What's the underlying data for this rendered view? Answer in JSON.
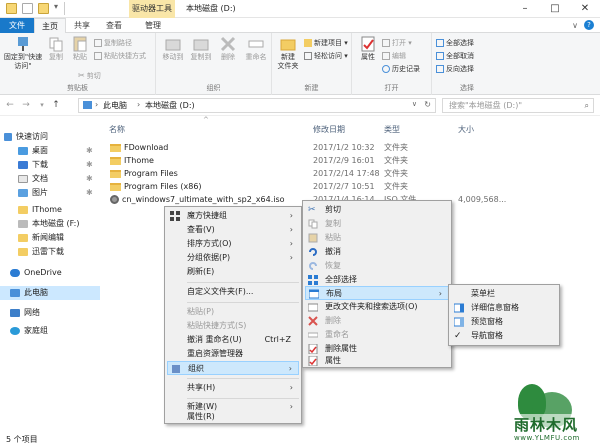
{
  "window": {
    "title": "本地磁盘 (D:)",
    "context_tab": "驱动器工具"
  },
  "ribbon_tabs": [
    {
      "label": "文件"
    },
    {
      "label": "主页"
    },
    {
      "label": "共享"
    },
    {
      "label": "查看"
    },
    {
      "label": "管理"
    }
  ],
  "ribbon": {
    "clipboard": {
      "label": "剪贴板",
      "pin": "固定到\"快速访问\"",
      "copy": "复制",
      "paste": "粘贴",
      "copy_path": "复制路径",
      "paste_shortcut": "粘贴快捷方式",
      "cut": "剪切"
    },
    "organize": {
      "label": "组织",
      "move_to": "移动到",
      "copy_to": "复制到",
      "delete": "删除",
      "rename": "重命名"
    },
    "new": {
      "label": "新建",
      "new_folder": "新建\n文件夹",
      "new_item": "新建项目",
      "easy_access": "轻松访问"
    },
    "open": {
      "label": "打开",
      "properties": "属性",
      "open": "打开",
      "edit": "编辑",
      "history": "历史记录"
    },
    "select": {
      "label": "选择",
      "select_all": "全部选择",
      "select_none": "全部取消",
      "invert": "反向选择"
    }
  },
  "address": {
    "path": [
      "此电脑",
      "本地磁盘 (D:)"
    ],
    "search_placeholder": "搜索\"本地磁盘 (D:)\""
  },
  "sidebar": {
    "items": [
      {
        "label": "快速访问"
      },
      {
        "label": "桌面"
      },
      {
        "label": "下载"
      },
      {
        "label": "文档"
      },
      {
        "label": "图片"
      },
      {
        "label": "IThome"
      },
      {
        "label": "本地磁盘 (F:)"
      },
      {
        "label": "新闻编辑"
      },
      {
        "label": "迅雷下载"
      },
      {
        "label": "OneDrive"
      },
      {
        "label": "此电脑"
      },
      {
        "label": "网络"
      },
      {
        "label": "家庭组"
      }
    ]
  },
  "columns": {
    "name": "名称",
    "date": "修改日期",
    "type": "类型",
    "size": "大小"
  },
  "files": [
    {
      "name": "FDownload",
      "date": "2017/1/2 10:32",
      "type": "文件夹",
      "size": ""
    },
    {
      "name": "IThome",
      "date": "2017/2/9 16:01",
      "type": "文件夹",
      "size": ""
    },
    {
      "name": "Program Files",
      "date": "2017/2/14 17:48",
      "type": "文件夹",
      "size": ""
    },
    {
      "name": "Program Files (x86)",
      "date": "2017/2/7 10:51",
      "type": "文件夹",
      "size": ""
    },
    {
      "name": "cn_windows7_ultimate_with_sp2_x64.iso",
      "date": "2017/1/4 16:14",
      "type": "ISO 文件",
      "size": "4,009,568..."
    }
  ],
  "status": {
    "count": "5 个项目"
  },
  "context_menu": {
    "items": [
      {
        "label": "魔方快捷组"
      },
      {
        "label": "查看(V)"
      },
      {
        "label": "排序方式(O)"
      },
      {
        "label": "分组依据(P)"
      },
      {
        "label": "刷新(E)"
      },
      {
        "label": "自定义文件夹(F)..."
      },
      {
        "label": "粘贴(P)"
      },
      {
        "label": "粘贴快捷方式(S)"
      },
      {
        "label": "撤消 重命名(U)",
        "accel": "Ctrl+Z"
      },
      {
        "label": "重启资源管理器"
      },
      {
        "label": "组织"
      },
      {
        "label": "共享(H)"
      },
      {
        "label": "新建(W)"
      },
      {
        "label": "属性(R)"
      }
    ]
  },
  "organize_submenu": {
    "items": [
      {
        "label": "剪切"
      },
      {
        "label": "复制"
      },
      {
        "label": "粘贴"
      },
      {
        "label": "撤消"
      },
      {
        "label": "恢复"
      },
      {
        "label": "全部选择"
      },
      {
        "label": "布局"
      },
      {
        "label": "更改文件夹和搜索选项(O)"
      },
      {
        "label": "删除"
      },
      {
        "label": "重命名"
      },
      {
        "label": "删除属性"
      },
      {
        "label": "属性"
      }
    ]
  },
  "layout_submenu": {
    "items": [
      {
        "label": "菜单栏"
      },
      {
        "label": "详细信息窗格"
      },
      {
        "label": "预览窗格"
      },
      {
        "label": "导航窗格"
      }
    ]
  },
  "watermark": {
    "text": "雨林木风",
    "url": "www.YLMFU.com"
  }
}
